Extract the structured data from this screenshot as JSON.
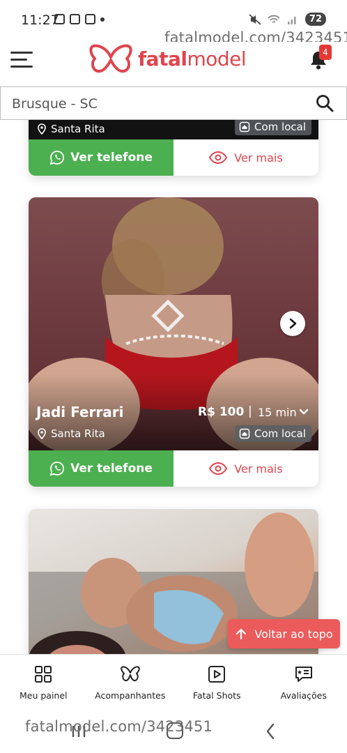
{
  "status_bar": {
    "time": "11:27",
    "battery": "72"
  },
  "watermark": "fatalmodel.com/3423451",
  "header": {
    "logo_text_bold": "fatal",
    "logo_text_regular": "model",
    "notification_count": "4"
  },
  "search": {
    "value": "Brusque - SC"
  },
  "cards": [
    {
      "location": "Santa Rita",
      "badge": "Com local",
      "phone_button": "Ver telefone",
      "more_button": "Ver mais"
    },
    {
      "name": "Jadi Ferrari",
      "price": "R$ 100",
      "separator": "|",
      "duration": "15 min",
      "location": "Santa Rita",
      "badge": "Com local",
      "phone_button": "Ver telefone",
      "more_button": "Ver mais"
    },
    {}
  ],
  "back_to_top": "Voltar ao topo",
  "bottom_nav": [
    {
      "label": "Meu painel",
      "icon": "dashboard-icon"
    },
    {
      "label": "Acompanhantes",
      "icon": "butterfly-icon"
    },
    {
      "label": "Fatal Shots",
      "icon": "play-icon"
    },
    {
      "label": "Avaliações",
      "icon": "review-icon"
    }
  ],
  "colors": {
    "brand": "#e0444d",
    "whatsapp_green": "#4caf50",
    "back_to_top": "#ec5b5b"
  }
}
